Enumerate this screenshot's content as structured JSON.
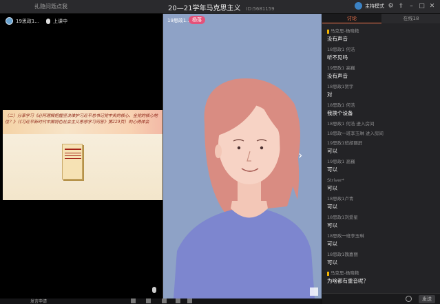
{
  "titlebar": {
    "left_text": "扎隐问题点我",
    "title": "20—21学年马克思主义",
    "room_id": "ID:5681159",
    "mode_label": "主持模式"
  },
  "left_panel": {
    "user_name": "19思政1...",
    "status": "上课中",
    "slide_text": "（二）分享学习《必阿理解把握坚决维护习近平总书记党中央的核心、全党的核心地位？》（《习近平新时代中国特色社会主义思想学习问答》第229页）的心得体会"
  },
  "center_panel": {
    "user_name": "19思政1...",
    "badge": "杨落"
  },
  "tabs": [
    "讨论",
    "在线18"
  ],
  "active_tab": 0,
  "chat": [
    {
      "name": "马克思-杨晓艳",
      "text": "没有声音",
      "host": true
    },
    {
      "name": "18思政1 何浩",
      "text": "听不见吗"
    },
    {
      "name": "19思政1 高巍",
      "text": "没有声音"
    },
    {
      "name": "18思政1贺宇",
      "text": "对"
    },
    {
      "name": "18思政1 何浩",
      "text": "我换个设备"
    },
    {
      "name": "18思政1 何浩 进入房间",
      "text": ""
    },
    {
      "name": "18思政一班李玉琳 进入房间",
      "text": ""
    },
    {
      "name": "19思政1班胡丽屏",
      "text": "可以"
    },
    {
      "name": "19思政1 高巍",
      "text": "可以"
    },
    {
      "name": "Striver*",
      "text": "可以"
    },
    {
      "name": "18思政1卢青",
      "text": "可以"
    },
    {
      "name": "18思政1刘爱星",
      "text": "可以"
    },
    {
      "name": "18思政一班李玉琳",
      "text": "可以"
    },
    {
      "name": "18思政1魏嘉丽",
      "text": "可以"
    },
    {
      "name": "马克思-杨晓艳",
      "text": "为啥都有重音呢？",
      "host": true
    }
  ],
  "chat_input": {
    "send_label": "发送"
  },
  "bottom": {
    "text": "发言申请"
  },
  "colors": {
    "accent": "#ff7b4f",
    "badge": "#e5527a",
    "host_mark": "#f4b400"
  }
}
